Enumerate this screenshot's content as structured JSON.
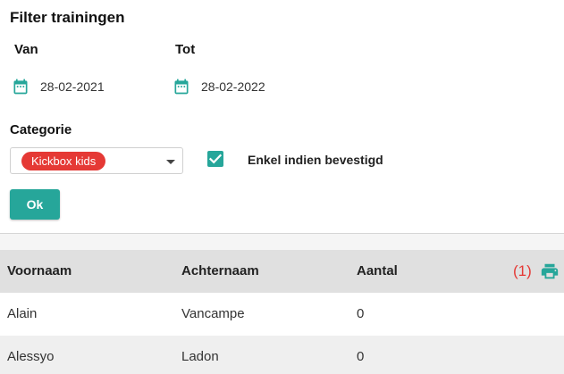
{
  "title": "Filter trainingen",
  "filters": {
    "van_label": "Van",
    "van_value": "28-02-2021",
    "tot_label": "Tot",
    "tot_value": "28-02-2022",
    "categorie_label": "Categorie",
    "categorie_selected": "Kickbox kids",
    "confirmed_label": "Enkel indien bevestigd",
    "confirmed_checked": true,
    "ok_label": "Ok"
  },
  "icons": {
    "date": "calendar-icon",
    "print": "print-icon"
  },
  "colors": {
    "accent": "#26a69a",
    "chip": "#e53935",
    "count": "#e53935"
  },
  "table": {
    "headers": [
      "Voornaam",
      "Achternaam",
      "Aantal"
    ],
    "print_count": "(1)",
    "rows": [
      [
        "Alain",
        "Vancampe",
        "0"
      ],
      [
        "Alessyo",
        "Ladon",
        "0"
      ]
    ]
  }
}
